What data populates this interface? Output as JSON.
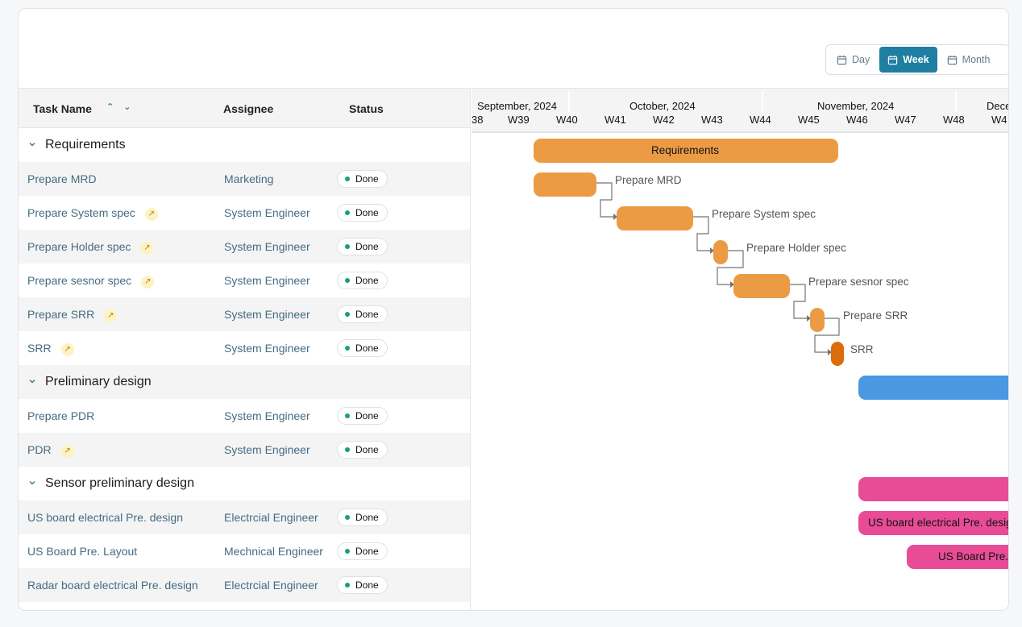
{
  "view_switch": {
    "options": [
      {
        "label": "Day",
        "active": false
      },
      {
        "label": "Week",
        "active": true
      },
      {
        "label": "Month",
        "active": false
      }
    ]
  },
  "grid": {
    "columns": [
      "Task Name",
      "Assignee",
      "Status"
    ],
    "rows": [
      {
        "type": "group",
        "label": "Requirements"
      },
      {
        "type": "task",
        "name": "Prepare MRD",
        "assignee": "Marketing",
        "status": "Done",
        "milestone": false
      },
      {
        "type": "task",
        "name": "Prepare System spec",
        "assignee": "System Engineer",
        "status": "Done",
        "milestone": true
      },
      {
        "type": "task",
        "name": "Prepare Holder spec",
        "assignee": "System Engineer",
        "status": "Done",
        "milestone": true
      },
      {
        "type": "task",
        "name": "Prepare sesnor spec",
        "assignee": "System Engineer",
        "status": "Done",
        "milestone": true
      },
      {
        "type": "task",
        "name": "Prepare SRR",
        "assignee": "System Engineer",
        "status": "Done",
        "milestone": true
      },
      {
        "type": "task",
        "name": "SRR",
        "assignee": "System Engineer",
        "status": "Done",
        "milestone": true
      },
      {
        "type": "group",
        "label": "Preliminary design"
      },
      {
        "type": "task",
        "name": "Prepare PDR",
        "assignee": "System Engineer",
        "status": "Done",
        "milestone": false
      },
      {
        "type": "task",
        "name": "PDR",
        "assignee": "System Engineer",
        "status": "Done",
        "milestone": true
      },
      {
        "type": "group",
        "label": "Sensor preliminary design"
      },
      {
        "type": "task",
        "name": "US board electrical Pre. design",
        "assignee": "Electrcial Engineer",
        "status": "Done",
        "milestone": false
      },
      {
        "type": "task",
        "name": "US Board Pre. Layout",
        "assignee": "Mechnical Engineer",
        "status": "Done",
        "milestone": false
      },
      {
        "type": "task",
        "name": "Radar board electrical Pre. design",
        "assignee": "Electrcial Engineer",
        "status": "Done",
        "milestone": true
      }
    ]
  },
  "timeline": {
    "months": [
      "September, 2024",
      "October, 2024",
      "November, 2024",
      "Dece"
    ],
    "weeks": [
      "38",
      "W39",
      "W40",
      "W41",
      "W42",
      "W43",
      "W44",
      "W45",
      "W46",
      "W47",
      "W48",
      "W4"
    ],
    "bar_labels": {
      "requirements": "Requirements",
      "prepare_mrd": "Prepare MRD",
      "prepare_system_spec": "Prepare System spec",
      "prepare_holder_spec": "Prepare Holder spec",
      "prepare_sensor_spec": "Prepare sesnor spec",
      "prepare_srr": "Prepare SRR",
      "srr": "SRR",
      "us_board_design": "US board electrical Pre. design",
      "us_board_layout": "US Board Pre. Layout"
    },
    "colors": {
      "requirements": "#ec9b45",
      "preliminary_design": "#4a97e2",
      "sensor_design": "#e84c96",
      "milestone_dark": "#dc6c0c",
      "link": "#757575"
    }
  }
}
